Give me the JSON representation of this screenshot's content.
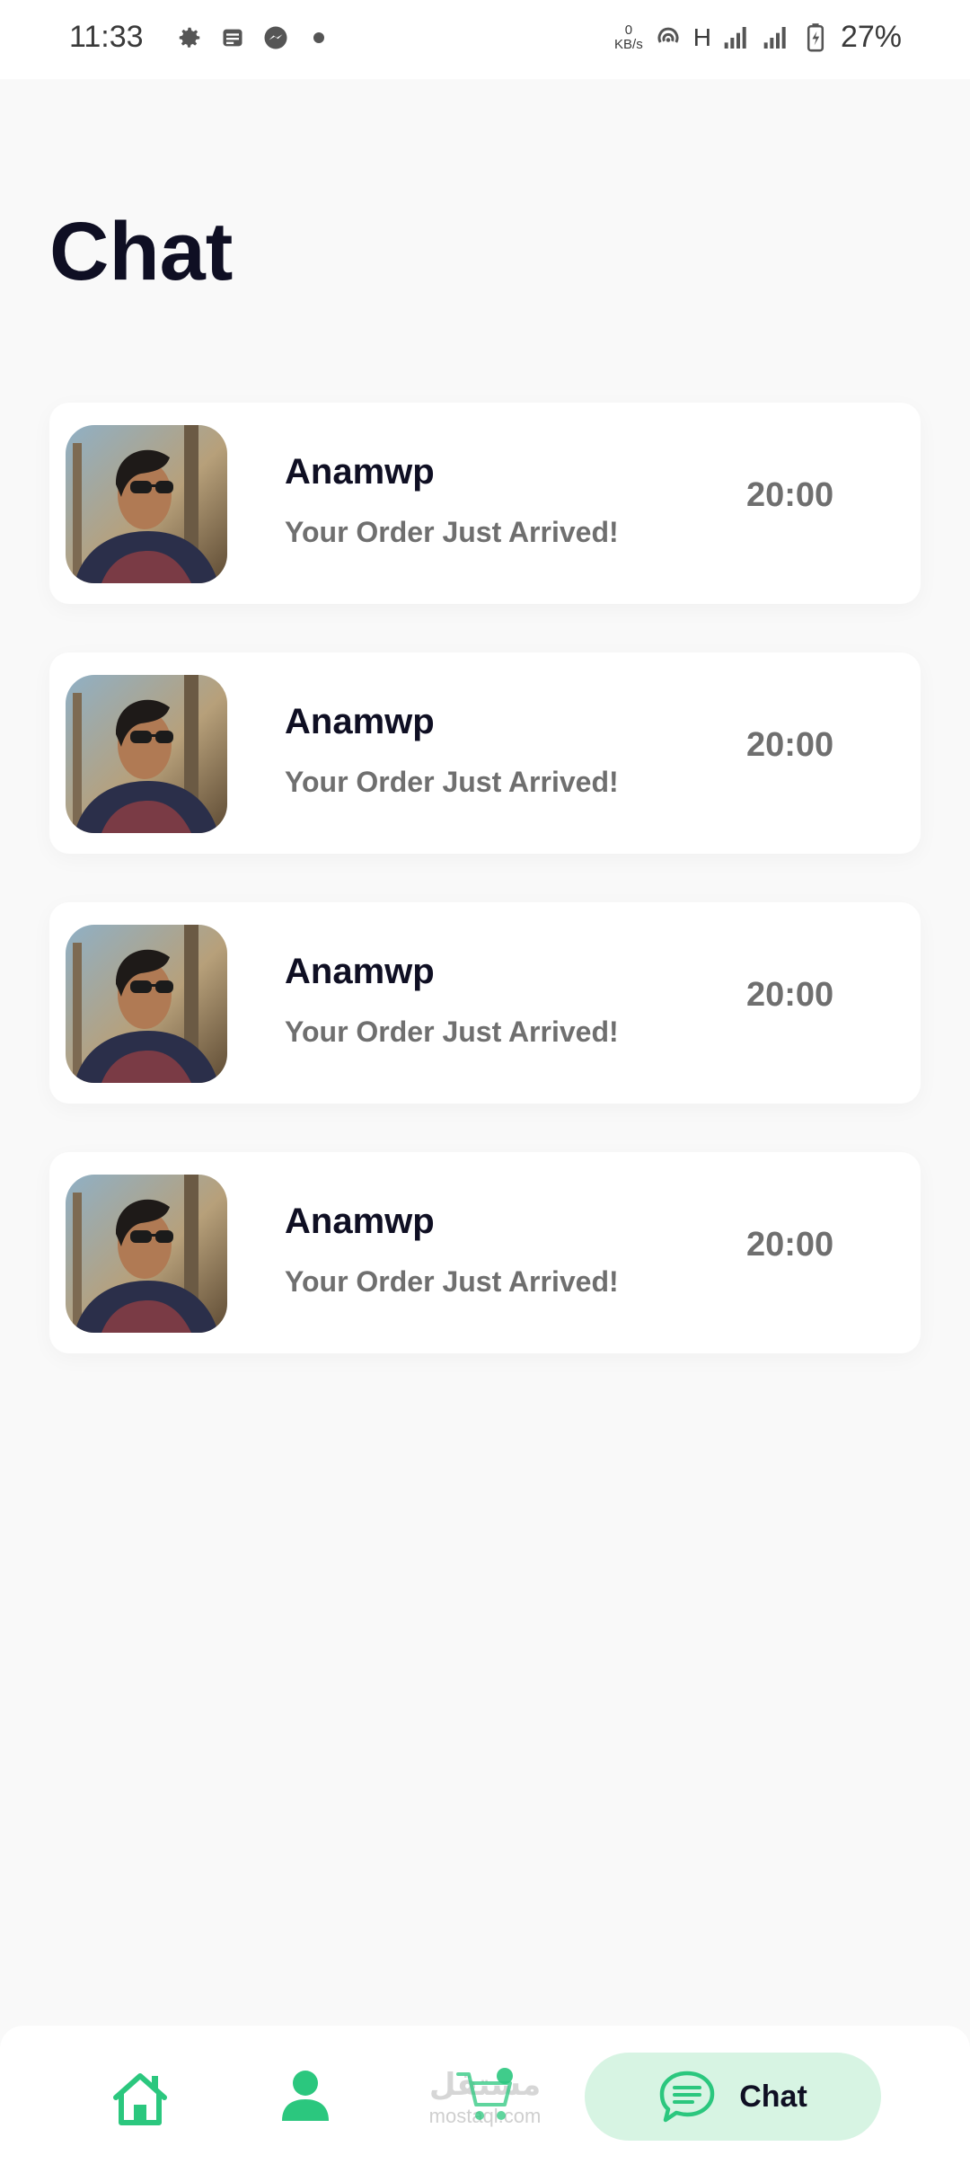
{
  "status_bar": {
    "time": "11:33",
    "net_speed_value": "0",
    "net_speed_unit": "KB/s",
    "network_type": "H",
    "battery": "27%",
    "icons": [
      "settings-icon",
      "news-icon",
      "messenger-icon",
      "dot-icon",
      "hotspot-icon",
      "signal-icon",
      "signal-icon",
      "battery-charging-icon"
    ]
  },
  "page": {
    "title": "Chat"
  },
  "chats": [
    {
      "name": "Anamwp",
      "message": "Your Order Just Arrived!",
      "time": "20:00"
    },
    {
      "name": "Anamwp",
      "message": "Your Order Just Arrived!",
      "time": "20:00"
    },
    {
      "name": "Anamwp",
      "message": "Your Order Just Arrived!",
      "time": "20:00"
    },
    {
      "name": "Anamwp",
      "message": "Your Order Just Arrived!",
      "time": "20:00"
    }
  ],
  "bottom_nav": {
    "items": [
      "home-icon",
      "profile-icon",
      "cart-icon",
      "chat-icon"
    ],
    "active_label": "Chat",
    "watermark_text": "مستقل",
    "watermark_sub": "mostaql.com"
  },
  "colors": {
    "accent": "#2bc77e",
    "active_bg": "#d7f4e3",
    "title": "#0f0f23",
    "muted": "#6f6f6f",
    "background": "#f9f9f9"
  }
}
